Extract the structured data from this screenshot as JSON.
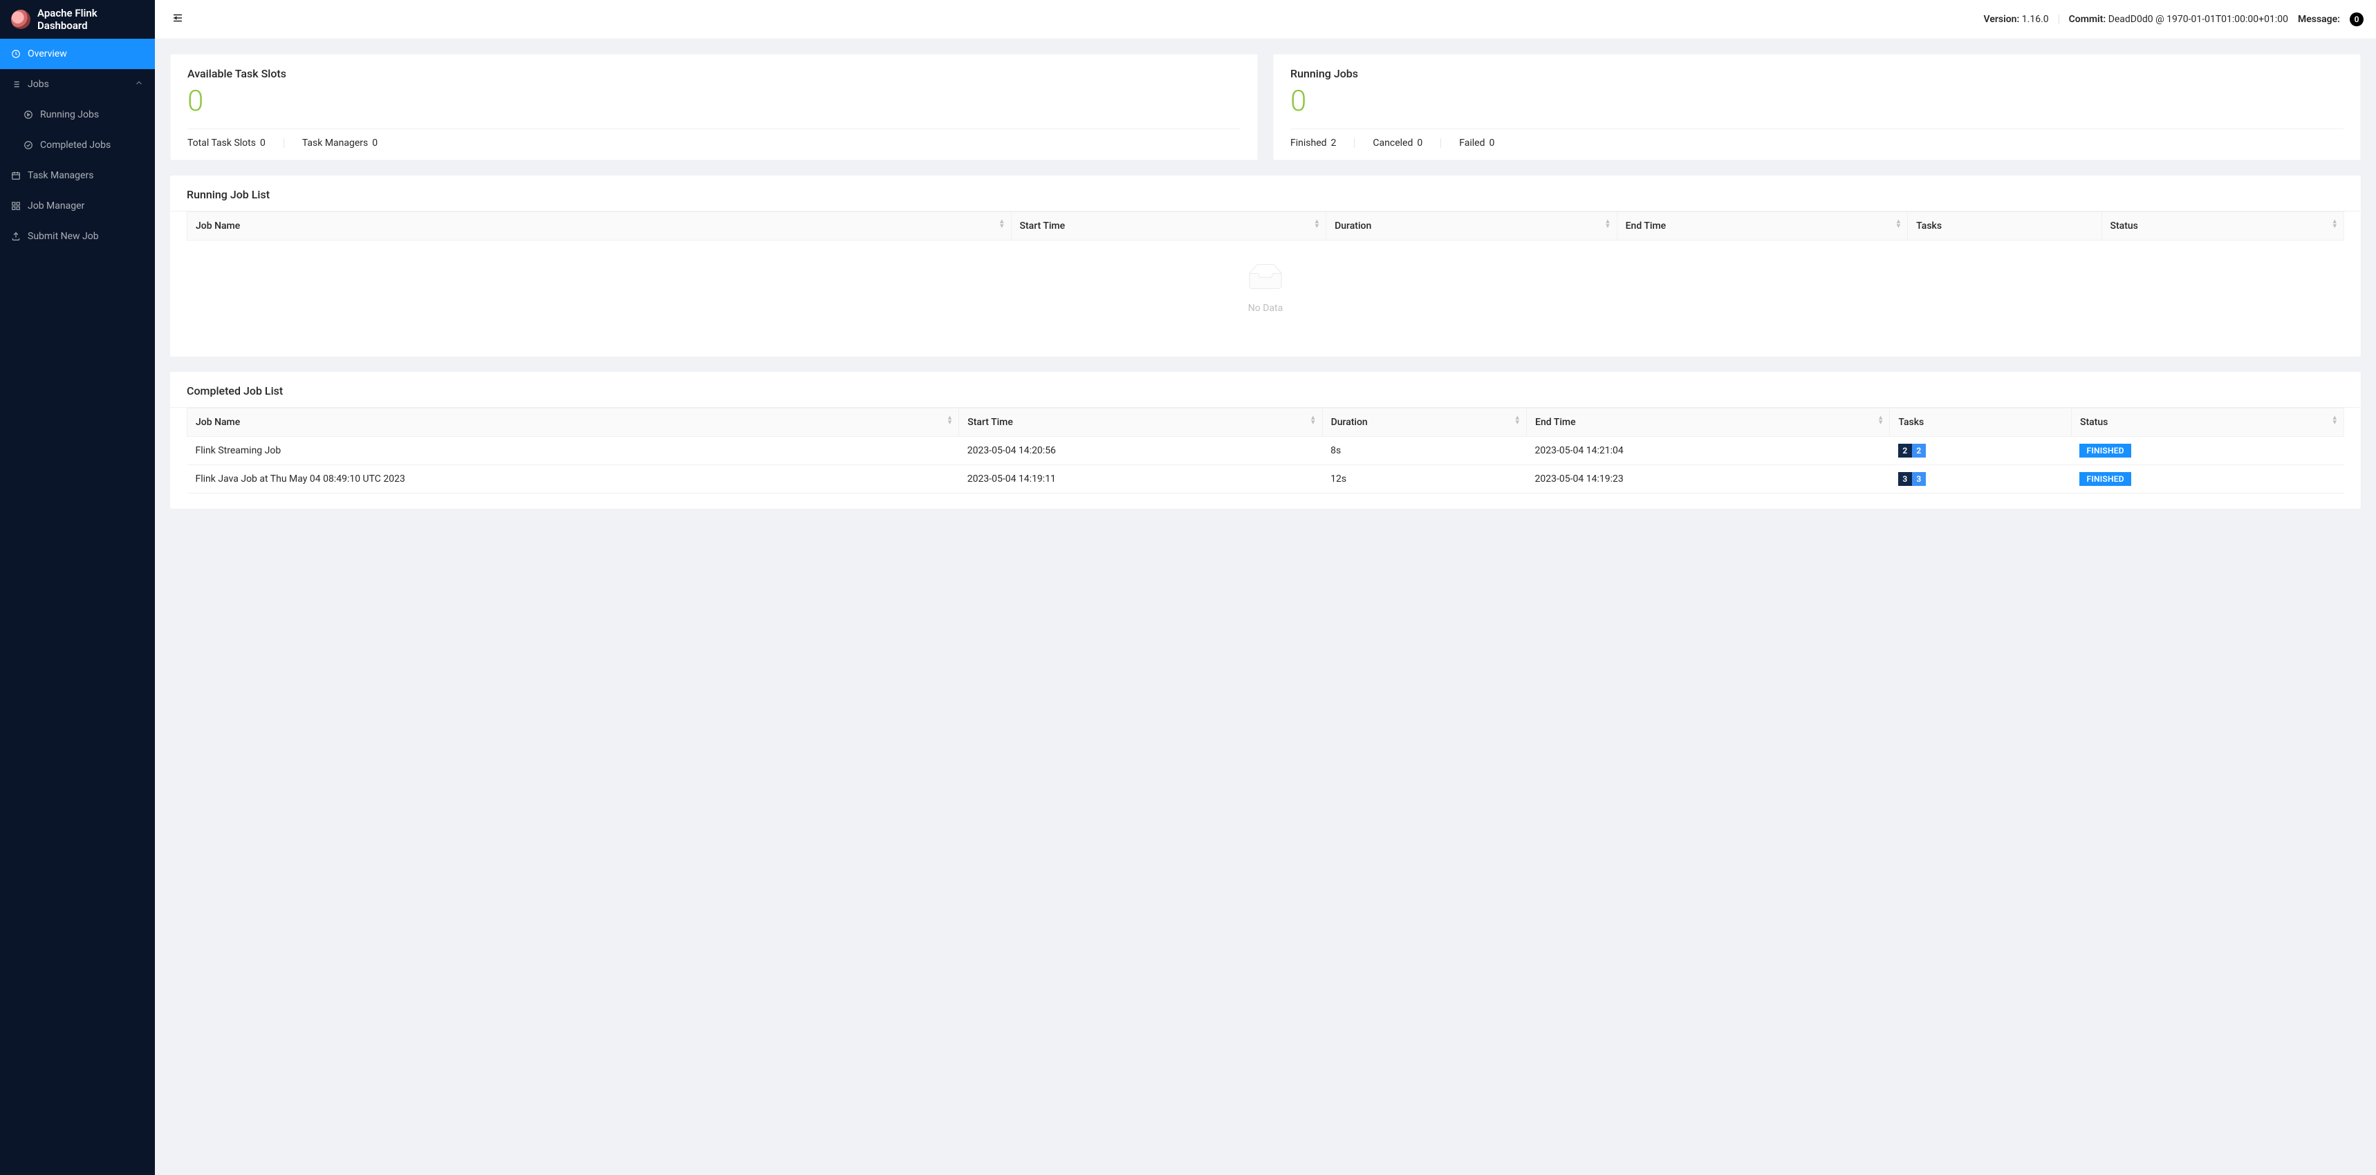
{
  "app_title": "Apache Flink Dashboard",
  "sidebar": {
    "overview": "Overview",
    "jobs": "Jobs",
    "running_jobs": "Running Jobs",
    "completed_jobs": "Completed Jobs",
    "task_managers": "Task Managers",
    "job_manager": "Job Manager",
    "submit_new_job": "Submit New Job"
  },
  "topbar": {
    "version_label": "Version:",
    "version_value": "1.16.0",
    "commit_label": "Commit:",
    "commit_value": "DeadD0d0 @ 1970-01-01T01:00:00+01:00",
    "message_label": "Message:",
    "message_count": "0"
  },
  "stats": {
    "slots": {
      "title": "Available Task Slots",
      "value": "0",
      "total_label": "Total Task Slots",
      "total_value": "0",
      "tm_label": "Task Managers",
      "tm_value": "0"
    },
    "jobs": {
      "title": "Running Jobs",
      "value": "0",
      "finished_label": "Finished",
      "finished_value": "2",
      "canceled_label": "Canceled",
      "canceled_value": "0",
      "failed_label": "Failed",
      "failed_value": "0"
    }
  },
  "running_panel": {
    "title": "Running Job List",
    "columns": {
      "job_name": "Job Name",
      "start_time": "Start Time",
      "duration": "Duration",
      "end_time": "End Time",
      "tasks": "Tasks",
      "status": "Status"
    },
    "empty": "No Data"
  },
  "completed_panel": {
    "title": "Completed Job List",
    "columns": {
      "job_name": "Job Name",
      "start_time": "Start Time",
      "duration": "Duration",
      "end_time": "End Time",
      "tasks": "Tasks",
      "status": "Status"
    },
    "rows": [
      {
        "name": "Flink Streaming Job",
        "start": "2023-05-04 14:20:56",
        "duration": "8s",
        "end": "2023-05-04 14:21:04",
        "task_a": "2",
        "task_b": "2",
        "status": "FINISHED"
      },
      {
        "name": "Flink Java Job at Thu May 04 08:49:10 UTC 2023",
        "start": "2023-05-04 14:19:11",
        "duration": "12s",
        "end": "2023-05-04 14:19:23",
        "task_a": "3",
        "task_b": "3",
        "status": "FINISHED"
      }
    ]
  }
}
